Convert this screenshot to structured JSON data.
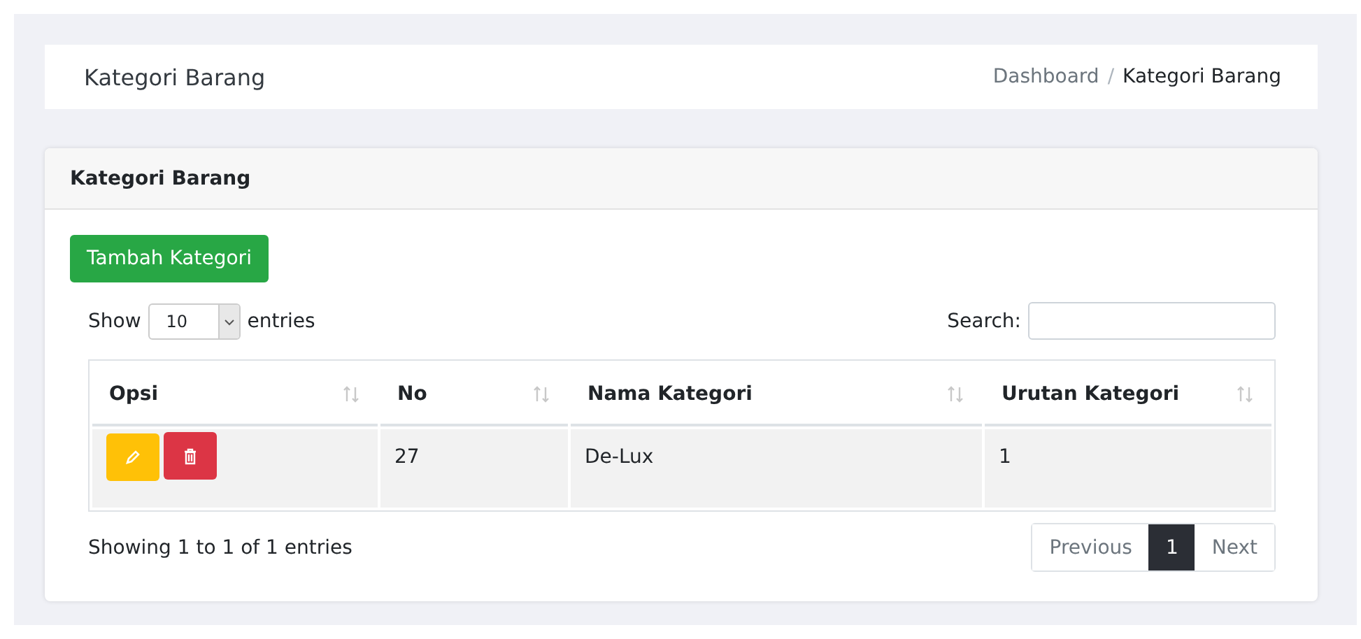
{
  "header": {
    "title": "Kategori Barang",
    "breadcrumb_separator": "/",
    "breadcrumb": [
      {
        "label": "Dashboard",
        "active": false
      },
      {
        "label": "Kategori Barang",
        "active": true
      }
    ]
  },
  "card": {
    "title": "Kategori Barang",
    "add_button": "Tambah Kategori",
    "length": {
      "before": "Show",
      "value": "10",
      "after": "entries"
    },
    "search": {
      "label": "Search:"
    },
    "table": {
      "columns": [
        "Opsi",
        "No",
        "Nama Kategori",
        "Urutan Kategori"
      ],
      "rows": [
        {
          "no": "27",
          "name": "De-Lux",
          "order": "1",
          "striped": true
        }
      ]
    },
    "info": "Showing 1 to 1 of 1 entries",
    "pagination": [
      {
        "label": "Previous",
        "selected": false
      },
      {
        "label": "1",
        "selected": true
      },
      {
        "label": "Next",
        "selected": false
      }
    ]
  }
}
